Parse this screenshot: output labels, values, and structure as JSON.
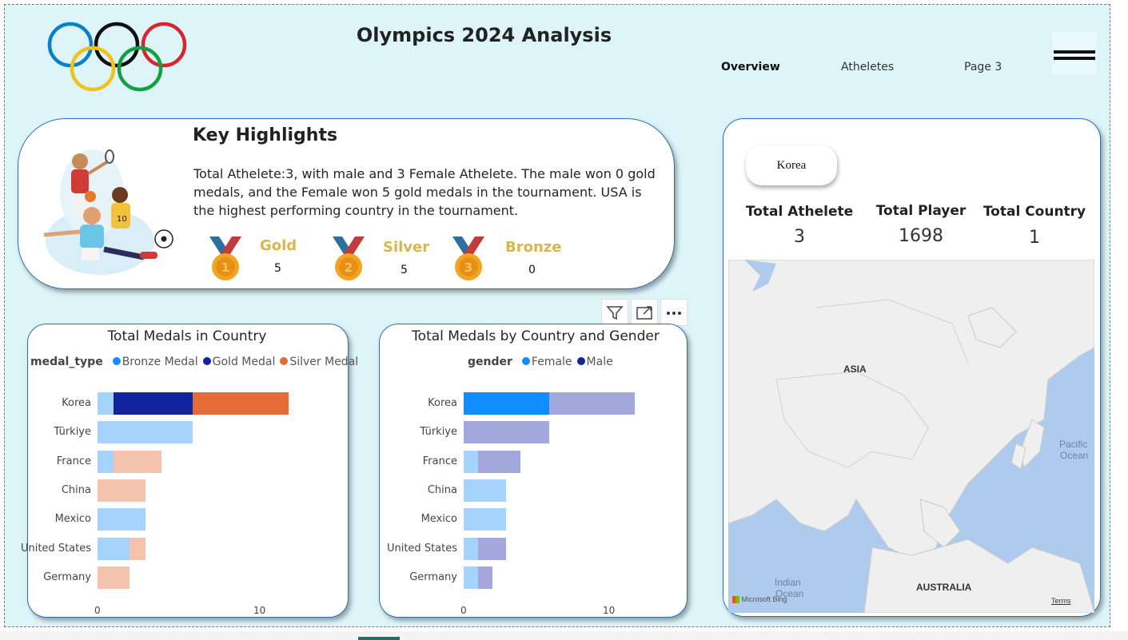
{
  "header": {
    "title": "Olympics 2024 Analysis",
    "nav": [
      "Overview",
      "Atheletes",
      "Page 3"
    ]
  },
  "key_highlights": {
    "title": "Key Highlights",
    "text": "Total Athelete:3, with male and 3 Female Athelete. The male won 0 gold medals, and the Female won 5 gold medals in the tournament. USA is the highest performing country in the tournament.",
    "medals": [
      {
        "label": "Gold",
        "value": "5",
        "number": "1"
      },
      {
        "label": "Silver",
        "value": "5",
        "number": "2"
      },
      {
        "label": "Bronze",
        "value": "0",
        "number": "3"
      }
    ]
  },
  "kpis": {
    "slicer_value": "Korea",
    "items": [
      {
        "label": "Total Athelete",
        "value": "3"
      },
      {
        "label": "Total Player",
        "value": "1698"
      },
      {
        "label": "Total Country",
        "value": "1"
      }
    ]
  },
  "map": {
    "labels": [
      "ASIA",
      "Pacific",
      "Ocean",
      "Indian",
      "Ocean",
      "AUSTRALIA"
    ],
    "attribution": "Microsoft Bing",
    "terms": "Terms"
  },
  "colors": {
    "bronze": "#a6d3fb",
    "gold": "#12239e",
    "gold_faded": "#a3a8dc",
    "silver": "#e66c37",
    "silver_faded": "#f5c3ad",
    "female": "#118dff",
    "female_faded": "#a6d3fb",
    "male_faded": "#a3a8dc"
  },
  "chart_data": [
    {
      "type": "bar",
      "title": "Total Medals in Country",
      "legend_title": "medal_type",
      "categories": [
        "Korea",
        "Türkiye",
        "France",
        "China",
        "Mexico",
        "United States",
        "Germany"
      ],
      "series": [
        {
          "name": "Bronze Medal",
          "values": [
            1,
            6,
            1,
            0,
            3,
            2,
            0
          ]
        },
        {
          "name": "Gold Medal",
          "values": [
            5,
            0,
            0,
            0,
            0,
            0,
            0
          ]
        },
        {
          "name": "Silver Medal",
          "values": [
            6,
            0,
            3,
            3,
            0,
            1,
            2
          ]
        }
      ],
      "highlight": "Korea",
      "x_ticks": [
        "0",
        "10"
      ],
      "xlim": [
        0,
        10
      ]
    },
    {
      "type": "bar",
      "title": "Total Medals by Country and Gender",
      "legend_title": "gender",
      "categories": [
        "Korea",
        "Türkiye",
        "France",
        "China",
        "Mexico",
        "United States",
        "Germany"
      ],
      "series": [
        {
          "name": "Female",
          "values": [
            6,
            0,
            1,
            3,
            3,
            1,
            1
          ]
        },
        {
          "name": "Male",
          "values": [
            6,
            6,
            3,
            0,
            0,
            2,
            1
          ]
        }
      ],
      "highlight": "Korea",
      "x_ticks": [
        "0",
        "10"
      ],
      "xlim": [
        0,
        10
      ]
    }
  ]
}
